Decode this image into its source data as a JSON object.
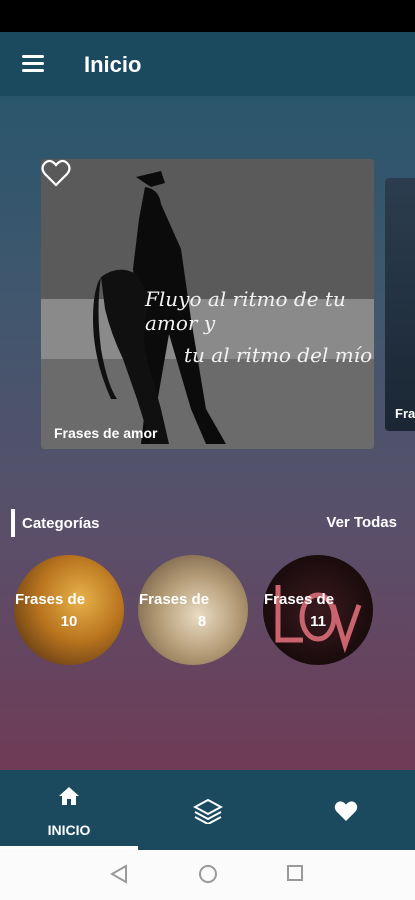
{
  "app_bar": {
    "title": "Inicio"
  },
  "featured": {
    "caption": "Frases de amor",
    "quote_line1": "Fluyo al ritmo de tu amor y",
    "quote_line2": "tu al ritmo del mío",
    "next_caption": "Fra"
  },
  "categories": {
    "title": "Categorías",
    "see_all": "Ver Todas",
    "items": [
      {
        "label": "Frases de",
        "count": "10"
      },
      {
        "label": "Frases de",
        "count": "8"
      },
      {
        "label": "Frases de",
        "count": "11"
      }
    ]
  },
  "bottom_nav": {
    "home_label": "INICIO"
  },
  "colors": {
    "bar": "#1b4a5f",
    "accent": "#ffffff"
  }
}
